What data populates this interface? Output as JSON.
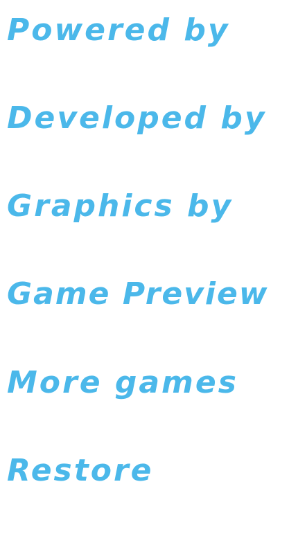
{
  "colors": {
    "text": "#4bb8ea",
    "background": "#ffffff"
  },
  "menu": {
    "items": [
      {
        "label": "Powered by"
      },
      {
        "label": "Developed by"
      },
      {
        "label": "Graphics by"
      },
      {
        "label": "Game Preview"
      },
      {
        "label": "More games"
      },
      {
        "label": "Restore"
      }
    ]
  }
}
